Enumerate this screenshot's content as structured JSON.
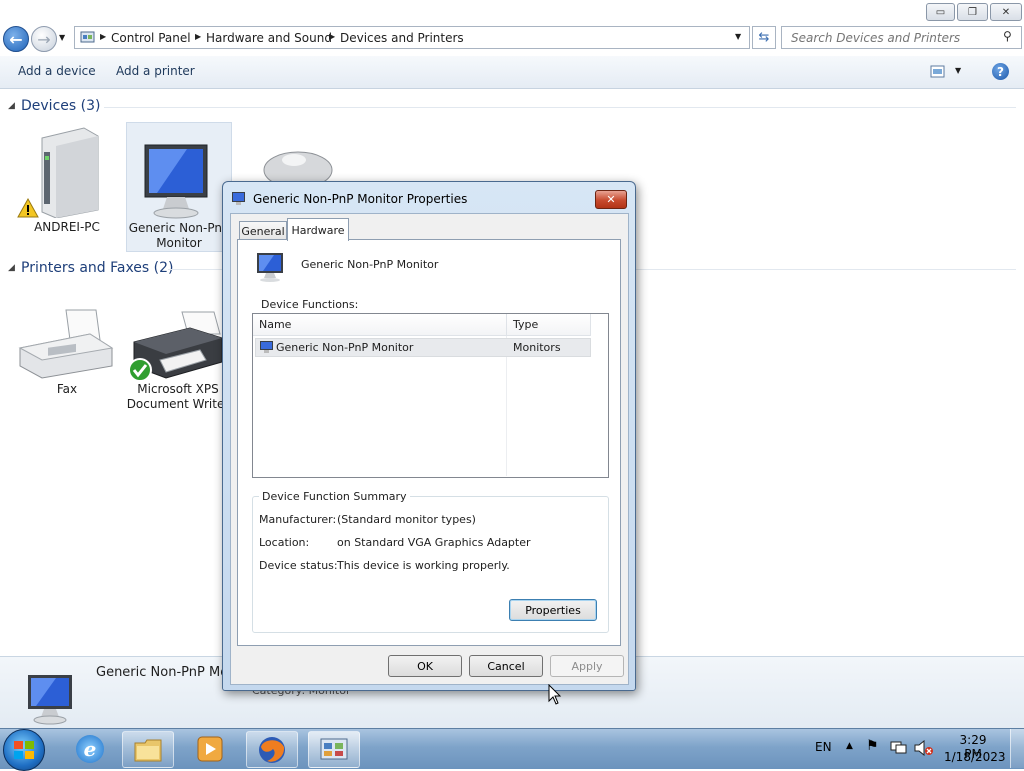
{
  "window": {
    "minimize": "▭",
    "maximize": "❐",
    "close": "✕"
  },
  "address": {
    "breadcrumbs": [
      "Control Panel",
      "Hardware and Sound",
      "Devices and Printers"
    ],
    "search_placeholder": "Search Devices and Printers"
  },
  "command_bar": {
    "add_device": "Add a device",
    "add_printer": "Add a printer"
  },
  "groups": {
    "devices": {
      "title": "Devices (3)",
      "items": [
        "ANDREI-PC",
        "Generic Non-PnP Monitor"
      ]
    },
    "printers": {
      "title": "Printers and Faxes (2)",
      "items": [
        "Fax",
        "Microsoft XPS Document Writer"
      ]
    }
  },
  "details_pane": {
    "name": "Generic Non-PnP Monitor",
    "category": "Category:  Monitor"
  },
  "dialog": {
    "title": "Generic Non-PnP Monitor Properties",
    "tabs": [
      "General",
      "Hardware"
    ],
    "device_name": "Generic Non-PnP Monitor",
    "device_functions_label": "Device Functions:",
    "columns": [
      "Name",
      "Type"
    ],
    "rows": [
      {
        "name": "Generic Non-PnP Monitor",
        "type": "Monitors"
      }
    ],
    "summary_title": "Device Function Summary",
    "summary": [
      {
        "label": "Manufacturer:",
        "value": "(Standard monitor types)"
      },
      {
        "label": "Location:",
        "value": "on Standard VGA Graphics Adapter"
      },
      {
        "label": "Device status:",
        "value": "This device is working properly."
      }
    ],
    "properties_button": "Properties",
    "ok": "OK",
    "cancel": "Cancel",
    "apply": "Apply"
  },
  "taskbar": {
    "language": "EN",
    "time": "3:29 PM",
    "date": "1/18/2023"
  }
}
